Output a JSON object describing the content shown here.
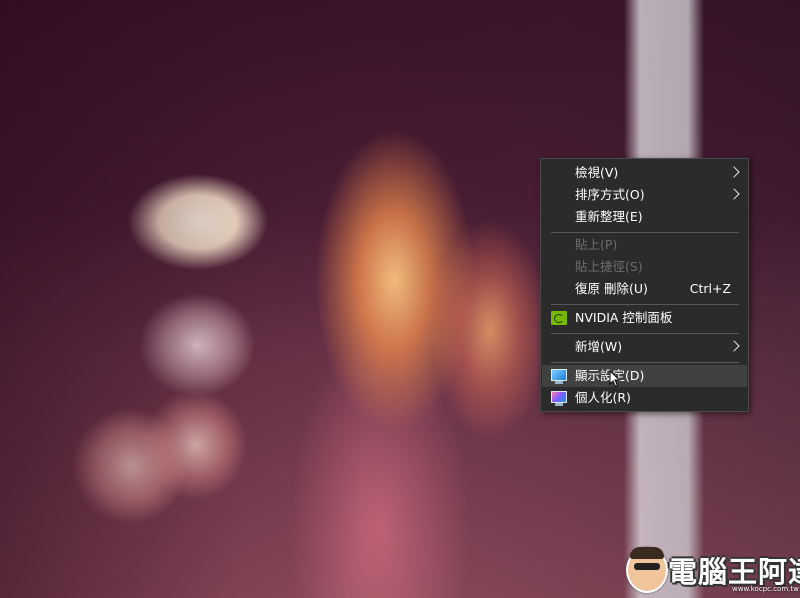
{
  "context_menu": {
    "items": [
      {
        "label": "檢視(V)",
        "submenu": true
      },
      {
        "label": "排序方式(O)",
        "submenu": true
      },
      {
        "label": "重新整理(E)"
      },
      {
        "label": "貼上(P)",
        "disabled": true
      },
      {
        "label": "貼上捷徑(S)",
        "disabled": true
      },
      {
        "label": "復原 刪除(U)",
        "shortcut": "Ctrl+Z"
      },
      {
        "label": "NVIDIA 控制面板",
        "icon": "nvidia-icon"
      },
      {
        "label": "新增(W)",
        "submenu": true
      },
      {
        "label": "顯示設定(D)",
        "icon": "display-settings-icon",
        "hovered": true
      },
      {
        "label": "個人化(R)",
        "icon": "personalize-icon"
      }
    ]
  },
  "watermark": {
    "text": "電腦王阿達",
    "url": "www.kocpc.com.tw"
  }
}
